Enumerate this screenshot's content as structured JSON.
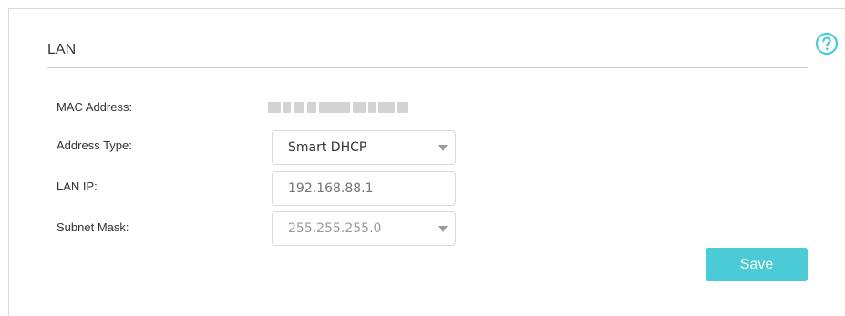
{
  "section": {
    "title": "LAN"
  },
  "help": {
    "icon": "question-circle-icon",
    "color": "#4acbd6"
  },
  "form": {
    "mac_label": "MAC Address:",
    "mac_value_note": "blurred / redacted",
    "address_type_label": "Address Type:",
    "address_type_value": "Smart DHCP",
    "lan_ip_label": "LAN IP:",
    "lan_ip_placeholder": "192.168.88.1",
    "subnet_mask_label": "Subnet Mask:",
    "subnet_mask_value": "255.255.255.0"
  },
  "actions": {
    "save_label": "Save",
    "save_color": "#4acbd6"
  }
}
